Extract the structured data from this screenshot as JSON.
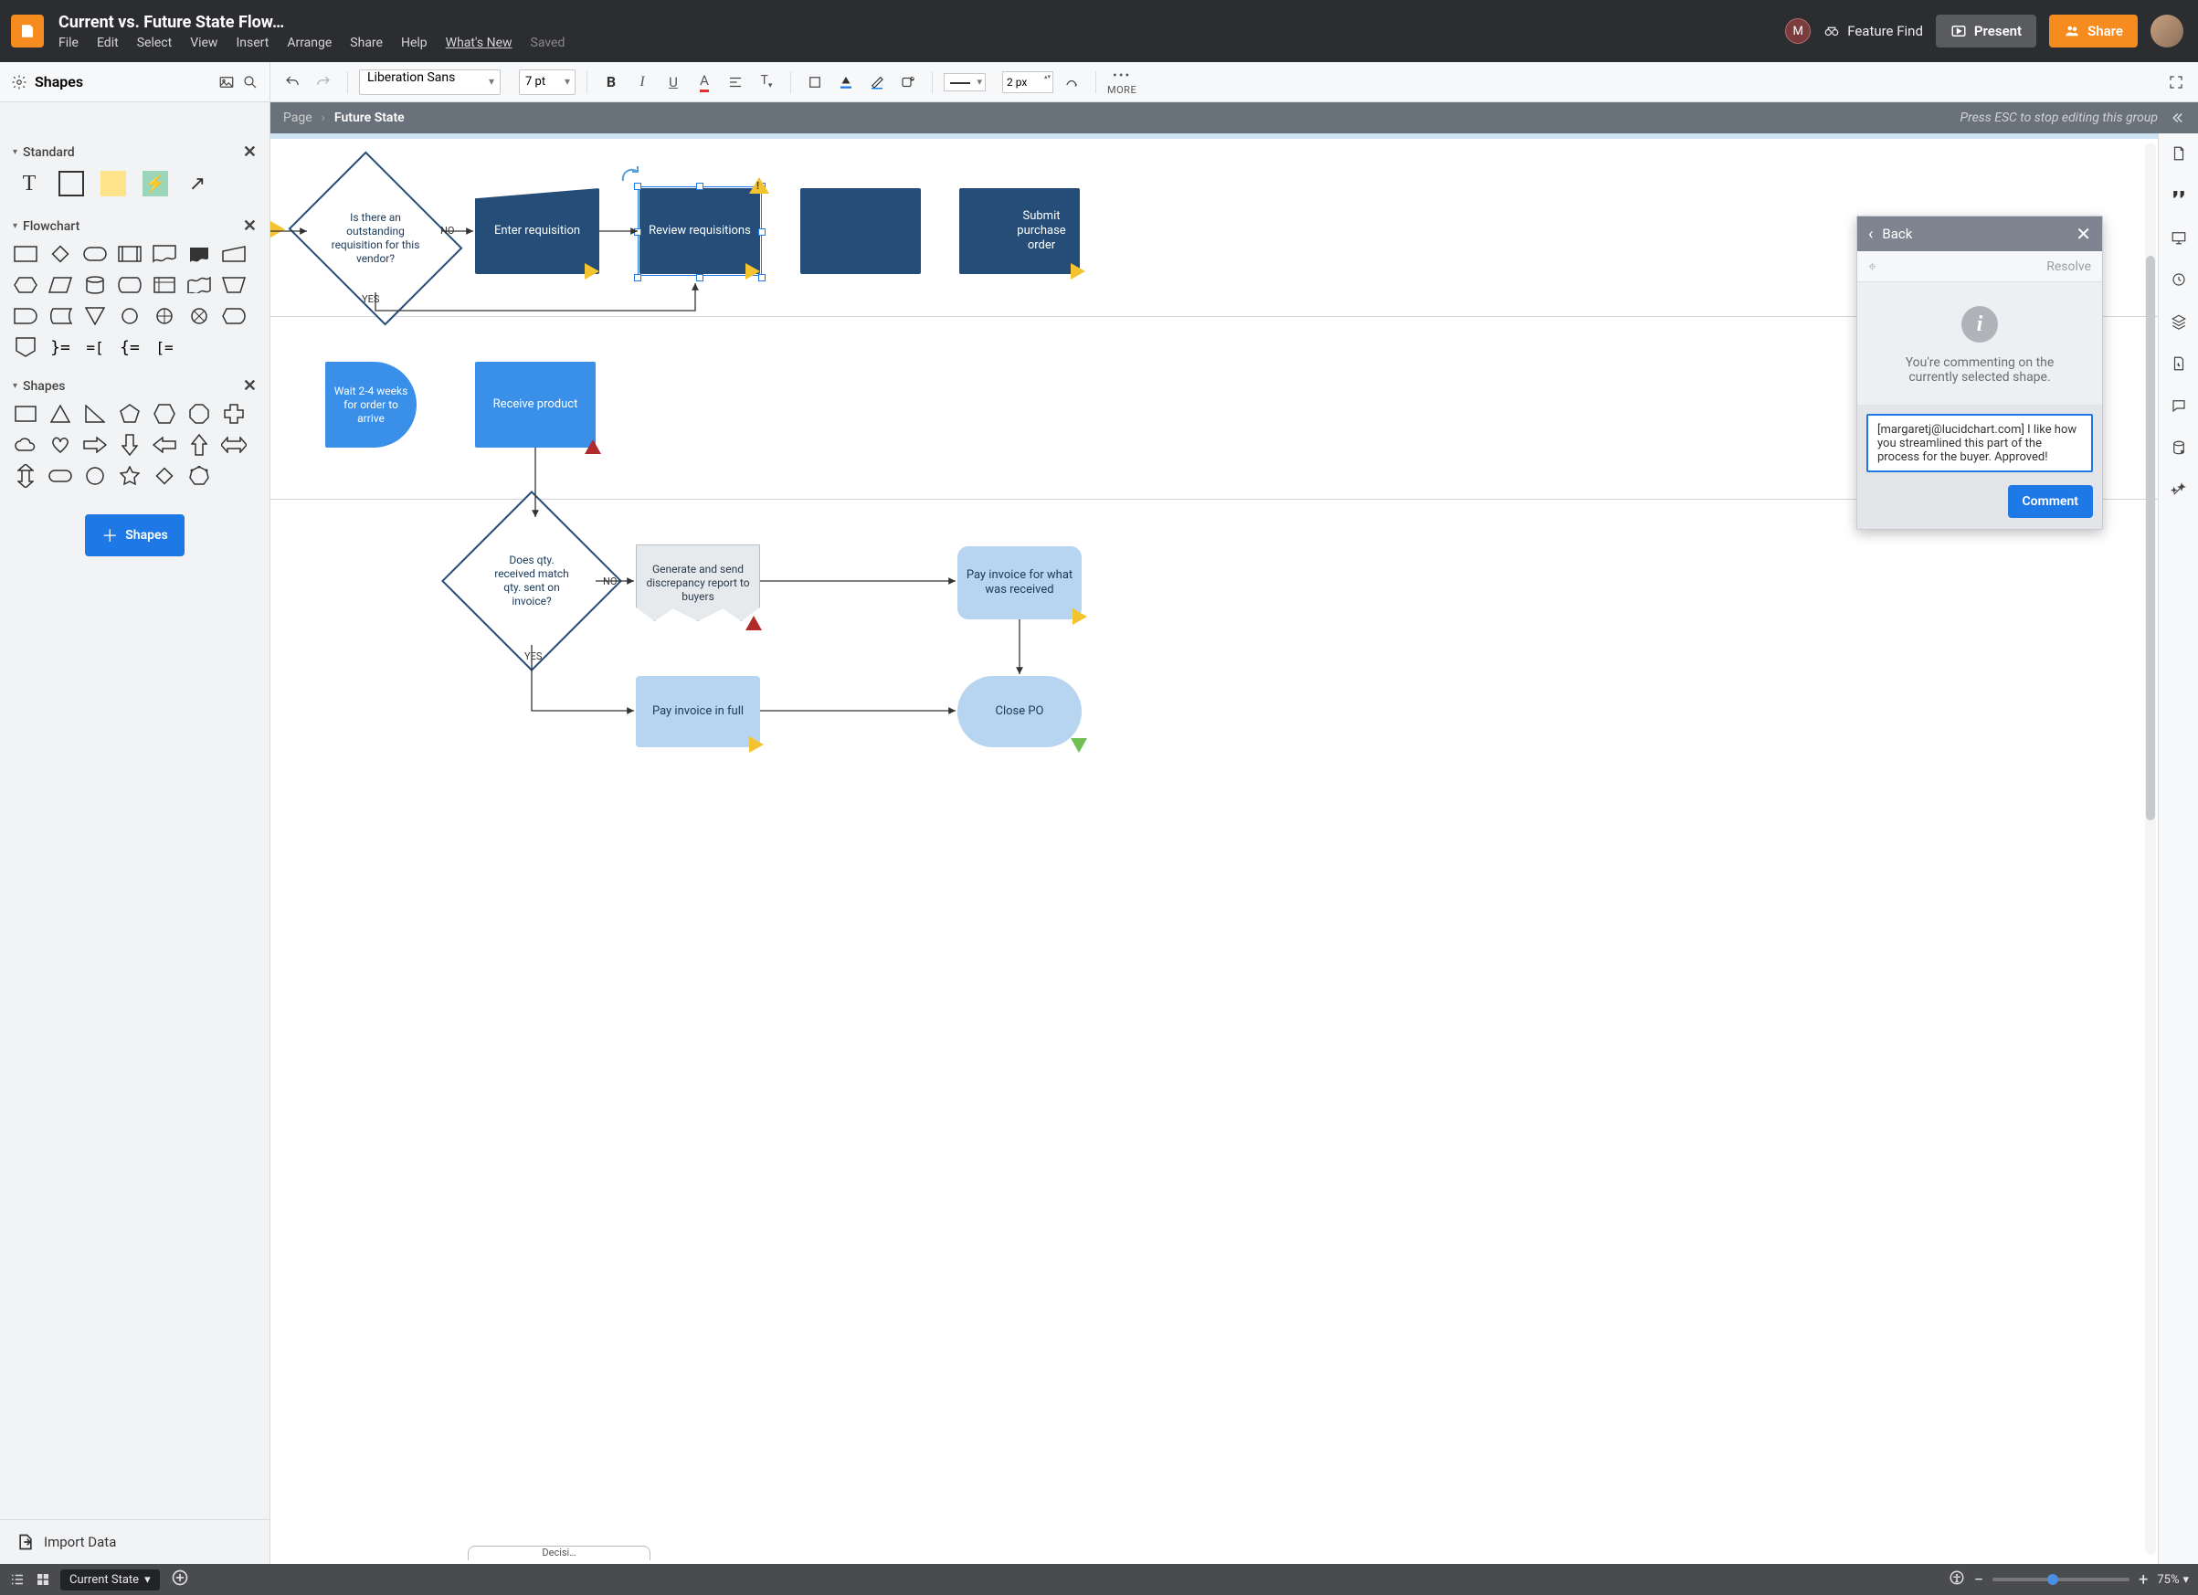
{
  "header": {
    "title": "Current vs. Future State Flow…",
    "menu": {
      "file": "File",
      "edit": "Edit",
      "select": "Select",
      "view": "View",
      "insert": "Insert",
      "arrange": "Arrange",
      "share": "Share",
      "help": "Help",
      "whatsnew": "What's New",
      "saved": "Saved"
    },
    "avatar_initial": "M",
    "feature_find": "Feature Find",
    "present": "Present",
    "share_btn": "Share"
  },
  "toolbar": {
    "shapes_label": "Shapes",
    "font": "Liberation Sans",
    "font_size": "7 pt",
    "line_px": "2 px",
    "more": "MORE"
  },
  "breadcrumb": {
    "page": "Page",
    "current": "Future State",
    "hint": "Press ESC to stop editing this group"
  },
  "sidebar": {
    "groups": {
      "standard": "Standard",
      "flowchart": "Flowchart",
      "shapes": "Shapes"
    },
    "btn_shapes": "Shapes",
    "import": "Import Data"
  },
  "canvas": {
    "decision1": "Is there an outstanding requisition for this vendor?",
    "d1_no": "NO",
    "d1_yes": "YES",
    "enter_req": "Enter requisition",
    "review_req": "Review requisitions",
    "submit_po": "Submit purchase order",
    "wait": "Wait 2-4 weeks for order to arrive",
    "receive": "Receive product",
    "decision2": "Does qty. received match qty. sent on invoice?",
    "d2_no": "NO",
    "d2_yes": "YES",
    "discrepancy": "Generate and send discrepancy report to buyers",
    "pay_partial": "Pay invoice for what was received",
    "pay_full": "Pay invoice in full",
    "close_po": "Close PO",
    "tab_label": "Decisi…"
  },
  "comment": {
    "back": "Back",
    "resolve": "Resolve",
    "info": "You're commenting on the currently selected shape.",
    "text": "[margaretj@lucidchart.com] I like how you streamlined this part of the process for the buyer. Approved!",
    "placeholder": "",
    "button": "Comment"
  },
  "footer": {
    "state": "Current State",
    "zoom": "75%"
  }
}
